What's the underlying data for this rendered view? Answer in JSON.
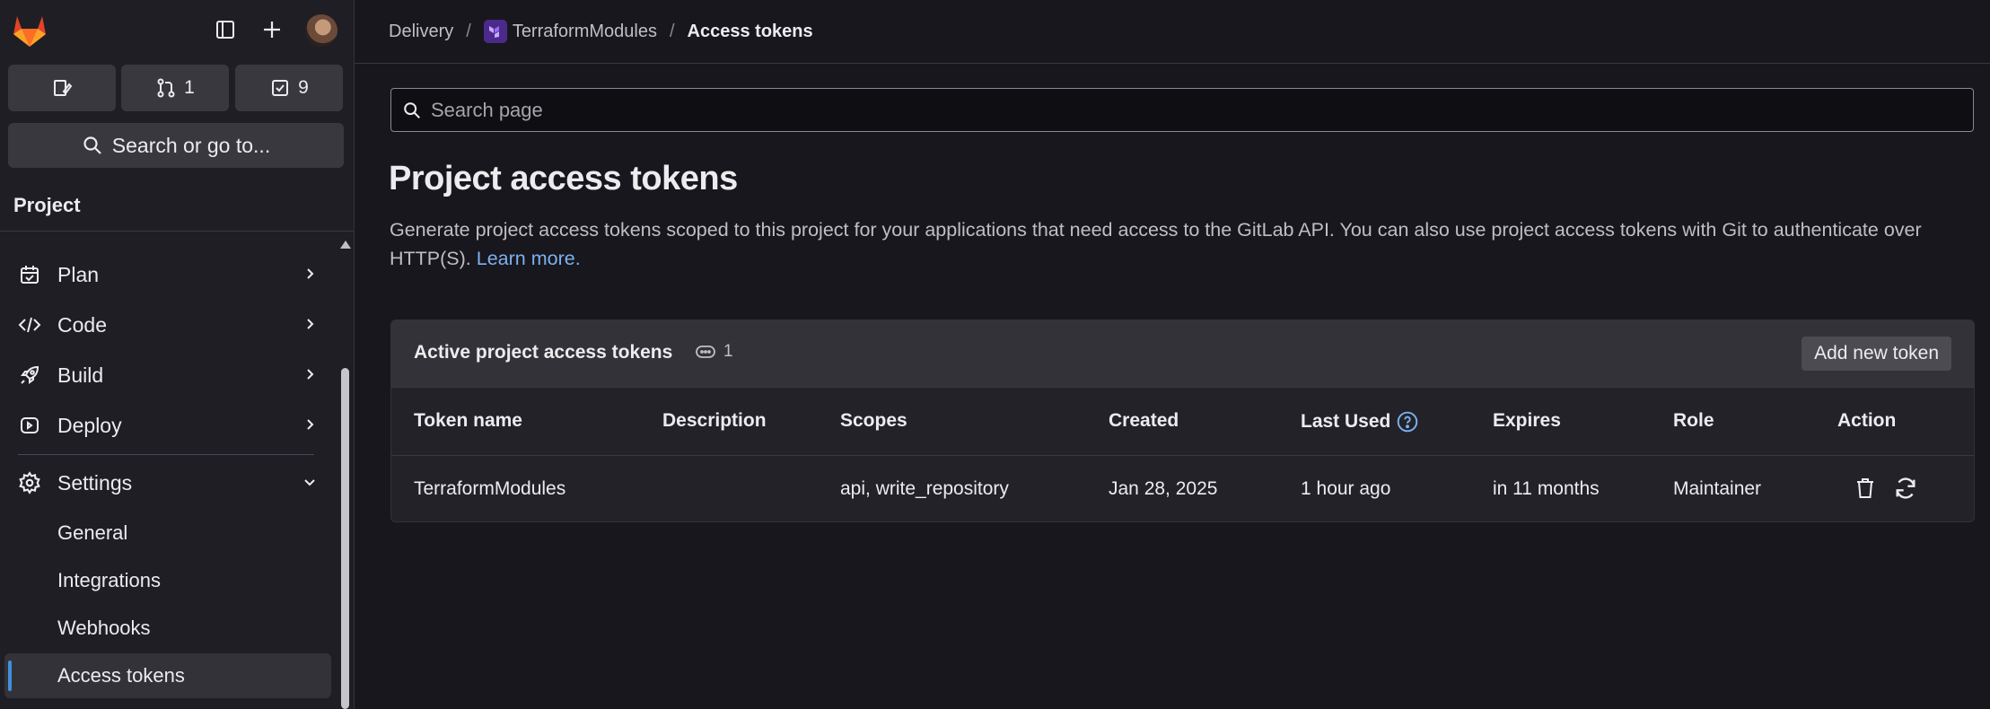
{
  "topbar": {
    "merge_requests_count": "1",
    "todos_count": "9",
    "search_label": "Search or go to..."
  },
  "sidebar": {
    "section_label": "Project",
    "items": [
      {
        "label": "Plan",
        "icon": "plan-icon"
      },
      {
        "label": "Code",
        "icon": "code-icon"
      },
      {
        "label": "Build",
        "icon": "rocket-icon"
      },
      {
        "label": "Deploy",
        "icon": "deploy-icon"
      },
      {
        "label": "Settings",
        "icon": "gear-icon"
      }
    ],
    "settings_sub": [
      "General",
      "Integrations",
      "Webhooks",
      "Access tokens"
    ],
    "active_sub": "Access tokens"
  },
  "breadcrumb": [
    "Delivery",
    "TerraformModules",
    "Access tokens"
  ],
  "search": {
    "placeholder": "Search page"
  },
  "page": {
    "title": "Project access tokens",
    "description": "Generate project access tokens scoped to this project for your applications that need access to the GitLab API. You can also use project access tokens with Git to authenticate over HTTP(S).",
    "learn_more": "Learn more."
  },
  "tokens": {
    "title": "Active project access tokens",
    "count": "1",
    "add_button": "Add new token",
    "columns": [
      "Token name",
      "Description",
      "Scopes",
      "Created",
      "Last Used",
      "Expires",
      "Role",
      "Action"
    ],
    "rows": [
      {
        "name": "TerraformModules",
        "description": "",
        "scopes": "api, write_repository",
        "created": "Jan 28, 2025",
        "last_used": "1 hour ago",
        "expires": "in 11 months",
        "role": "Maintainer"
      }
    ]
  },
  "colors": {
    "accent": "#428fdc",
    "link": "#7db1f0",
    "background": "#18171d",
    "sidebar": "#1f1e24"
  }
}
